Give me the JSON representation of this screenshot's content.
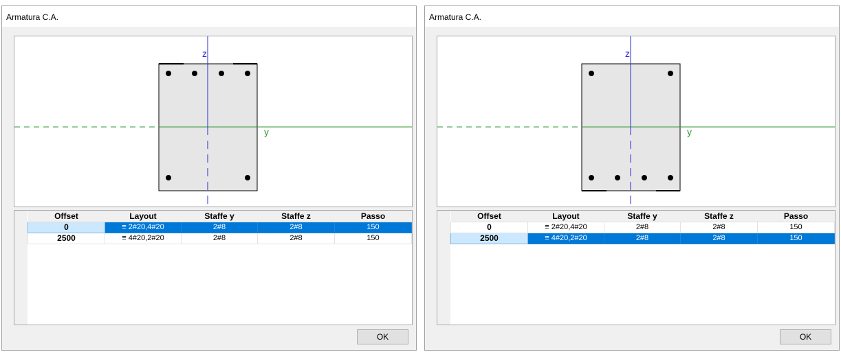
{
  "dialogs": [
    {
      "title": "Armatura C.A.",
      "axis_labels": {
        "z": "z",
        "y": "y"
      },
      "section": {
        "top_bars": 4,
        "bottom_bars": 2
      },
      "columns": [
        "Offset",
        "Layout",
        "Staffe y",
        "Staffe z",
        "Passo"
      ],
      "rows": [
        {
          "offset": "0",
          "layout": "≡ 2#20,4#20",
          "staffe_y": "2#8",
          "staffe_z": "2#8",
          "passo": "150",
          "selected": true
        },
        {
          "offset": "2500",
          "layout": "≡ 4#20,2#20",
          "staffe_y": "2#8",
          "staffe_z": "2#8",
          "passo": "150",
          "selected": false
        }
      ],
      "ok_label": "OK"
    },
    {
      "title": "Armatura C.A.",
      "axis_labels": {
        "z": "z",
        "y": "y"
      },
      "section": {
        "top_bars": 2,
        "bottom_bars": 4
      },
      "columns": [
        "Offset",
        "Layout",
        "Staffe y",
        "Staffe z",
        "Passo"
      ],
      "rows": [
        {
          "offset": "0",
          "layout": "≡ 2#20,4#20",
          "staffe_y": "2#8",
          "staffe_z": "2#8",
          "passo": "150",
          "selected": false
        },
        {
          "offset": "2500",
          "layout": "≡ 4#20,2#20",
          "staffe_y": "2#8",
          "staffe_z": "2#8",
          "passo": "150",
          "selected": true
        }
      ],
      "ok_label": "OK"
    }
  ],
  "colors": {
    "y_axis": "#2e9a2e",
    "z_axis": "#2b2bd6",
    "section_fill": "#e6e6e6",
    "selection": "#0078d7"
  }
}
